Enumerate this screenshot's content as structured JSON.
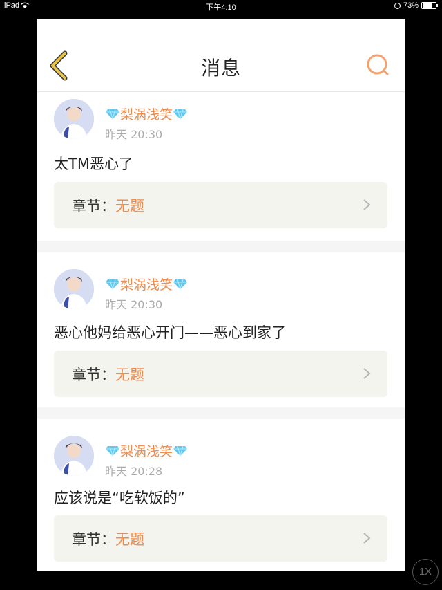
{
  "status_bar": {
    "device": "iPad",
    "time": "下午4:10",
    "battery": "73%",
    "battery_level": 0.73
  },
  "nav": {
    "title": "消息",
    "back_icon": "chevron-left-icon",
    "search_icon": "search-icon"
  },
  "messages": [
    {
      "username": "梨涡浅笑",
      "timestamp": "昨天 20:30",
      "text": "太TM恶心了",
      "chapter_label": "章节：",
      "chapter_value": "无题"
    },
    {
      "username": "梨涡浅笑",
      "timestamp": "昨天 20:30",
      "text": "恶心他妈给恶心开门——恶心到家了",
      "chapter_label": "章节：",
      "chapter_value": "无题"
    },
    {
      "username": "梨涡浅笑",
      "timestamp": "昨天 20:28",
      "text": "应该说是“吃软饭的”",
      "chapter_label": "章节：",
      "chapter_value": "无题"
    }
  ],
  "zoom": "1X",
  "colors": {
    "accent": "#f08b4c",
    "back_icon": "#e8c54a",
    "chapter_bg": "#f4f4ee"
  }
}
